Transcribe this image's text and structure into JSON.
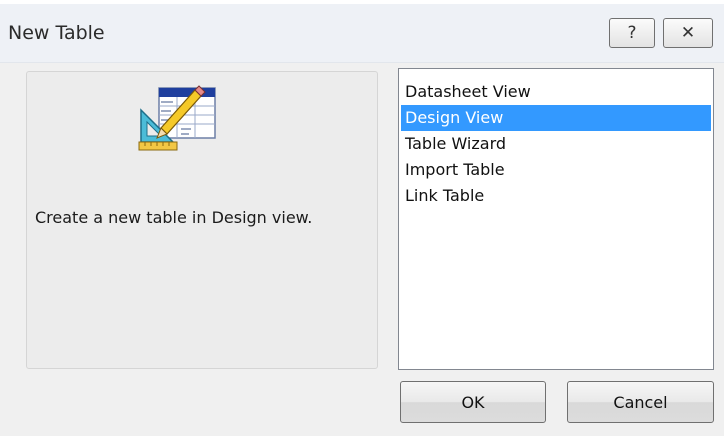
{
  "window": {
    "title": "New Table",
    "help_glyph": "?",
    "close_glyph": "✕"
  },
  "preview": {
    "icon": "table-design-icon",
    "description": "Create a new table in Design view."
  },
  "view_list": {
    "items": [
      {
        "label": "Datasheet View",
        "selected": false
      },
      {
        "label": "Design View",
        "selected": true
      },
      {
        "label": "Table Wizard",
        "selected": false
      },
      {
        "label": "Import Table",
        "selected": false
      },
      {
        "label": "Link Table",
        "selected": false
      }
    ]
  },
  "buttons": {
    "ok_label": "OK",
    "cancel_label": "Cancel"
  },
  "colors": {
    "selection": "#3399ff"
  }
}
